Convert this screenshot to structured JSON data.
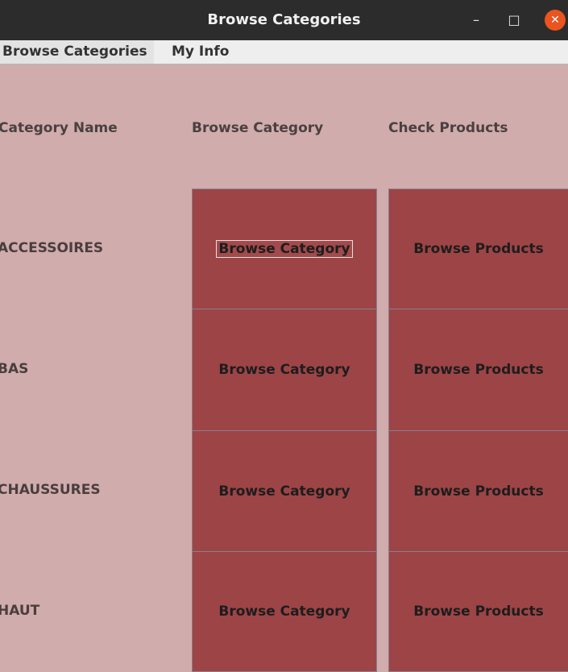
{
  "window": {
    "title": "Browse Categories",
    "minimize_glyph": "–",
    "maximize_glyph": "□",
    "close_glyph": "✕"
  },
  "menubar": {
    "items": [
      "Browse Categories",
      "My Info"
    ]
  },
  "table": {
    "headers": [
      "Category Name",
      "Browse Category",
      "Check Products"
    ],
    "rows": [
      {
        "name": "ACCESSOIRES",
        "browse_label": "Browse Category",
        "products_label": "Browse Products"
      },
      {
        "name": "BAS",
        "browse_label": "Browse Category",
        "products_label": "Browse Products"
      },
      {
        "name": "CHAUSSURES",
        "browse_label": "Browse Category",
        "products_label": "Browse Products"
      },
      {
        "name": "HAUT",
        "browse_label": "Browse Category",
        "products_label": "Browse Products"
      }
    ]
  },
  "colors": {
    "background": "#d0acac",
    "button": "#9d4446",
    "titlebar": "#2c2c2c",
    "close_button": "#e95420"
  }
}
